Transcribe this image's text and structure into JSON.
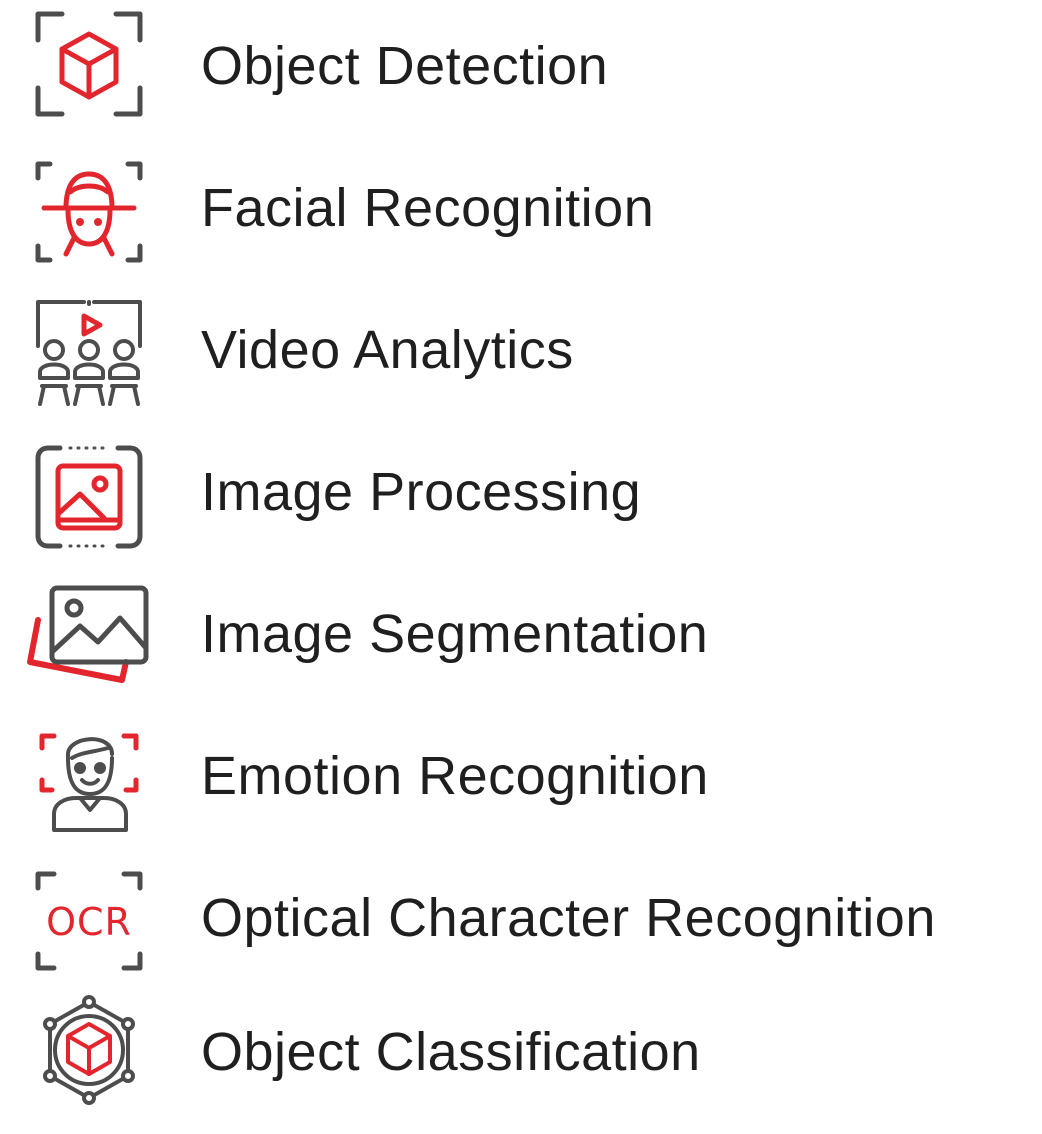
{
  "colors": {
    "accent": "#e3262e",
    "icon_gray": "#4d4d4d",
    "text": "#1f1f1f",
    "background": "#ffffff"
  },
  "items": [
    {
      "label": "Object Detection",
      "icon": "cube-scan-icon"
    },
    {
      "label": "Facial Recognition",
      "icon": "face-scan-icon"
    },
    {
      "label": "Video Analytics",
      "icon": "video-audience-icon"
    },
    {
      "label": "Image Processing",
      "icon": "image-frame-icon"
    },
    {
      "label": "Image Segmentation",
      "icon": "image-stack-icon"
    },
    {
      "label": "Emotion Recognition",
      "icon": "smiling-person-scan-icon"
    },
    {
      "label": "Optical Character Recognition",
      "icon": "ocr-scan-icon"
    },
    {
      "label": "Object Classification",
      "icon": "cube-network-icon"
    }
  ]
}
